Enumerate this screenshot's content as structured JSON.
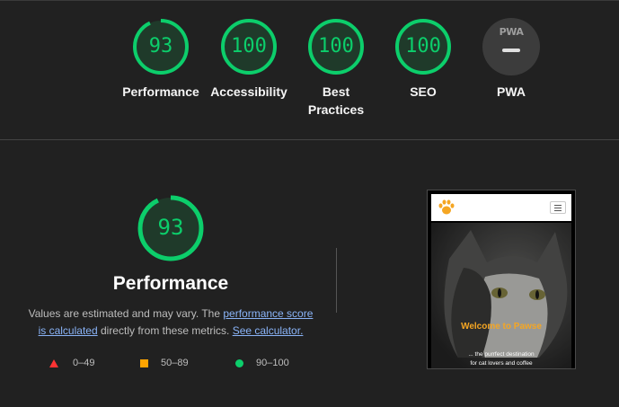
{
  "summary": {
    "gauges": [
      {
        "score": "93",
        "label_line1": "Performance",
        "label_line2": ""
      },
      {
        "score": "100",
        "label_line1": "Accessibility",
        "label_line2": ""
      },
      {
        "score": "100",
        "label_line1": "Best",
        "label_line2": "Practices"
      },
      {
        "score": "100",
        "label_line1": "SEO",
        "label_line2": ""
      }
    ],
    "pwa": {
      "logo_text": "PWA",
      "label": "PWA"
    },
    "colors": {
      "pass": "#0cce6b",
      "average": "#ffa400",
      "fail": "#ff3333"
    }
  },
  "performance": {
    "score": "93",
    "score_fraction": 0.93,
    "title": "Performance",
    "note_prefix": "Values are estimated and may vary. The ",
    "note_link1": "performance score is calculated",
    "note_middle": " directly from these metrics. ",
    "note_link2": "See calculator."
  },
  "legend": [
    {
      "icon": "triangle-icon",
      "range": "0–49"
    },
    {
      "icon": "square-icon",
      "range": "50–89"
    },
    {
      "icon": "circle-icon",
      "range": "90–100"
    }
  ],
  "screenshot": {
    "title": "Welcome to Pawse",
    "subtitle_line1": "... the purrfect destination",
    "subtitle_line2": "for cat lovers and coffee"
  }
}
